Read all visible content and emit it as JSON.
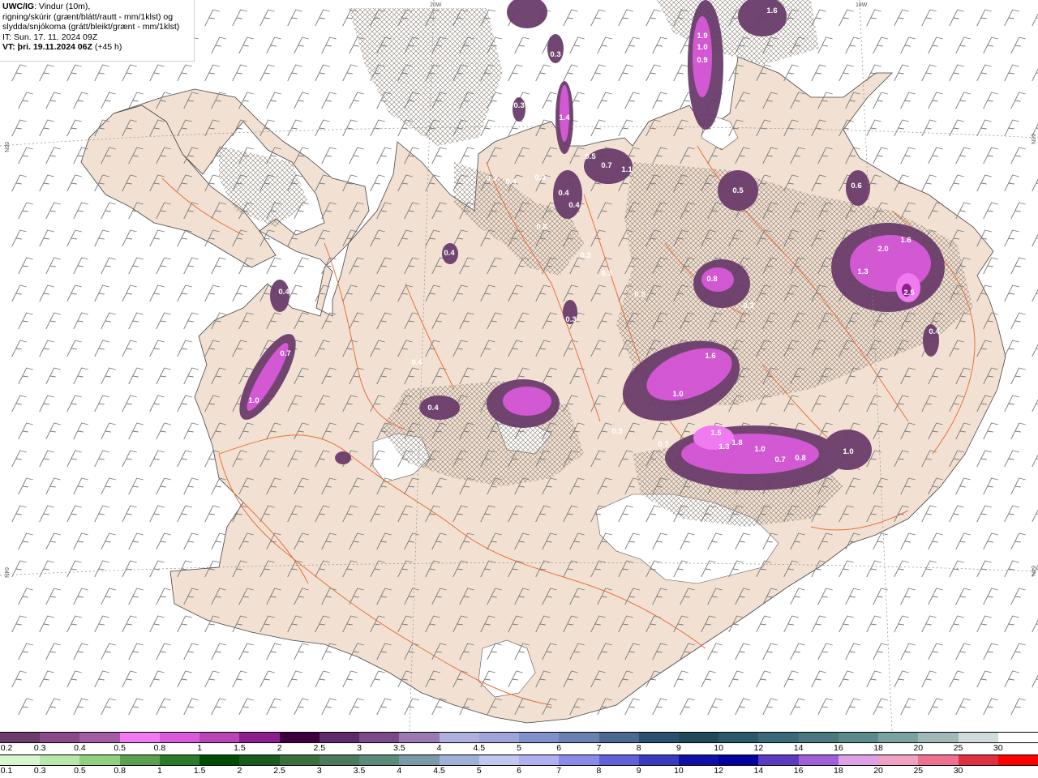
{
  "title": {
    "model": "UWC/IG",
    "description": ": Vindur (10m),",
    "line2": "rigning/skúrir (grænt/blátt/rautt - mm/1klst) og",
    "line3": "slydda/snjókoma (grátt/bleikt/grænt - mm/1klst)",
    "it": "IT: Sun. 17. 11. 2024 09Z",
    "vt_label": "VT: þri. 19.11.2024 06Z",
    "vt_offset": " (+45 h)"
  },
  "colors": {
    "sea": "#ffffff",
    "land": "#f2e1d2",
    "roads": "#e8703a",
    "barbs": "#7a7a7a",
    "hatch": "#8a7e74"
  },
  "grid_labels": [
    "20W",
    "18W",
    "66N",
    "64N",
    "66N",
    "64N"
  ],
  "precip_labels": [
    "1.6",
    "1.9",
    "1.0",
    "0.9",
    "0.3",
    "0.3",
    "1.4",
    "0.5",
    "0.7",
    "1.1",
    "0.3",
    "0.4",
    "0.3",
    "0.4",
    "0.4",
    "0.8",
    "0.5",
    "0.6",
    "2.0",
    "1.6",
    "1.3",
    "2.5",
    "0.4",
    "0.3",
    "0.3",
    "0.8",
    "0.3",
    "0.3",
    "0.4",
    "0.7",
    "1.0",
    "0.4",
    "0.3",
    "0.4",
    "0.3",
    "1.6",
    "1.0",
    "0.3",
    "1.5",
    "1.3",
    "1.8",
    "1.0",
    "0.7",
    "0.8",
    "1.0",
    "0.7",
    "0.4"
  ],
  "legend_snow": {
    "labels": [
      "0.2",
      "0.3",
      "0.4",
      "0.5",
      "0.8",
      "1",
      "1.5",
      "2",
      "2.5",
      "3",
      "3.5",
      "4",
      "4.5",
      "5",
      "6",
      "7",
      "8",
      "9",
      "10",
      "12",
      "14",
      "16",
      "18",
      "20",
      "25",
      "30"
    ],
    "colors": [
      "#6b3d6b",
      "#8a4a8a",
      "#a35ca3",
      "#f07af0",
      "#d95ad9",
      "#b845b8",
      "#8c1f8c",
      "#3d003d",
      "#5e2a6a",
      "#7a4a8a",
      "#9a7ab0",
      "#b0b0e0",
      "#9fa5d8",
      "#8090c8",
      "#6a80b0",
      "#4a6890",
      "#2a5070",
      "#1f4a5a",
      "#2a5a6a",
      "#3a6a7a",
      "#4a7a80",
      "#5a8a8a",
      "#7aa0a0",
      "#a0b8b8",
      "#d0dcdc",
      "#ffffff"
    ]
  },
  "legend_rain": {
    "labels": [
      "0.1",
      "0.3",
      "0.5",
      "0.8",
      "1",
      "1.5",
      "2",
      "2.5",
      "3",
      "3.5",
      "4",
      "4.5",
      "5",
      "6",
      "7",
      "8",
      "9",
      "10",
      "12",
      "14",
      "16",
      "18",
      "20",
      "25",
      "30"
    ],
    "colors": [
      "#d9f5d0",
      "#b8e8a8",
      "#90d080",
      "#5aa050",
      "#2a7a2a",
      "#004d00",
      "#1a5a1a",
      "#3a6e3a",
      "#4a7a5a",
      "#5a8a7a",
      "#7a9aa8",
      "#a0b0d8",
      "#c0c8f0",
      "#b0b0f0",
      "#8a8ae8",
      "#6060d8",
      "#3a3ac0",
      "#1010a8",
      "#0000a0",
      "#5a3ac0",
      "#a060d8",
      "#e0a0e8",
      "#f0a0c0",
      "#f07090",
      "#e03040",
      "#ff0000"
    ]
  }
}
